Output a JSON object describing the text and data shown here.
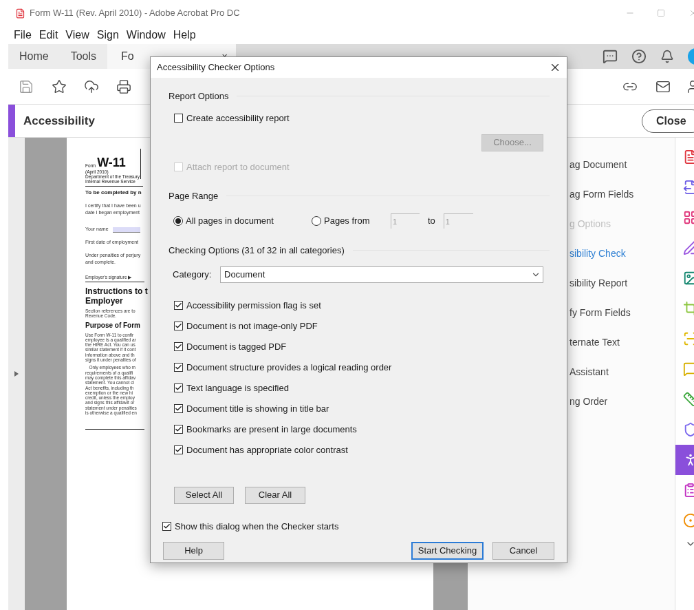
{
  "window": {
    "title": "Form W-11 (Rev. April 2010) - Adobe Acrobat Pro DC"
  },
  "menu": [
    "File",
    "Edit",
    "View",
    "Sign",
    "Window",
    "Help"
  ],
  "tabs": [
    {
      "label": "Home",
      "selected": false
    },
    {
      "label": "Tools",
      "selected": false
    },
    {
      "label": "Fo",
      "selected": true,
      "close": "×"
    }
  ],
  "panel": {
    "title": "Accessibility",
    "close_button": "Close"
  },
  "document": {
    "form_word": "Form",
    "form_number": "W-11",
    "header_lines": [
      "(April 2010)",
      "Department of the Treasury",
      "Internal Revenue Service"
    ],
    "blocks": [
      {
        "kind": "bold",
        "lines": [
          "To be completed by n"
        ]
      },
      {
        "kind": "body",
        "lines": [
          "I certify that I have been u",
          "date I began employment"
        ]
      },
      {
        "kind": "field",
        "lines": [
          "Your name"
        ]
      },
      {
        "kind": "body",
        "lines": [
          "First date of employment"
        ]
      },
      {
        "kind": "body",
        "lines": [
          "Under penalties of perjury",
          "and complete."
        ]
      },
      {
        "kind": "signature",
        "lines": [
          "Employer's signature ▶"
        ]
      },
      {
        "kind": "heading",
        "lines": [
          "Instructions to t",
          "Employer"
        ]
      },
      {
        "kind": "small",
        "lines": [
          "Section references are to",
          "Revenue Code."
        ]
      },
      {
        "kind": "subheading",
        "lines": [
          "Purpose of Form"
        ]
      },
      {
        "kind": "small",
        "lines": [
          "Use Form W-11 to confir",
          "employee is a qualified ar",
          "the HIRE Act. You can us",
          "similar statement if it cont",
          "information above and th",
          "signs it under penalties of"
        ]
      },
      {
        "kind": "small",
        "lines": [
          "   Only employees who m",
          "requirements of a qualifi",
          "may complete this affidav",
          "statement. You cannot cl",
          "Act benefits, including th",
          "exemption or the new hi",
          "credit, unless the employ",
          "and signs this affidavit or",
          "statement under penalties",
          "is otherwise a qualified en"
        ]
      }
    ]
  },
  "tools": [
    {
      "label": "ag Document",
      "selected": false,
      "disabled": false
    },
    {
      "label": "ag Form Fields",
      "selected": false,
      "disabled": false
    },
    {
      "label": "g Options",
      "selected": false,
      "disabled": true
    },
    {
      "label": "sibility Check",
      "selected": true,
      "disabled": false
    },
    {
      "label": "sibility Report",
      "selected": false,
      "disabled": false
    },
    {
      "label": "fy Form Fields",
      "selected": false,
      "disabled": false
    },
    {
      "label": "ternate Text",
      "selected": false,
      "disabled": false
    },
    {
      "label": "Assistant",
      "selected": false,
      "disabled": false
    },
    {
      "label": "ng Order",
      "selected": false,
      "disabled": false
    }
  ],
  "rail": [
    {
      "kind": "create",
      "color": "#e0363f",
      "selected": false
    },
    {
      "kind": "export",
      "color": "#6b5be5",
      "selected": false
    },
    {
      "kind": "organize",
      "color": "#e0357a",
      "selected": false
    },
    {
      "kind": "edit",
      "color": "#9a55e0",
      "selected": false
    },
    {
      "kind": "image",
      "color": "#13866f",
      "selected": false
    },
    {
      "kind": "crop",
      "color": "#8cc63f",
      "selected": false
    },
    {
      "kind": "scan",
      "color": "#e0b800",
      "selected": false
    },
    {
      "kind": "comment",
      "color": "#d8b000",
      "selected": false
    },
    {
      "kind": "measure",
      "color": "#3da83d",
      "selected": false
    },
    {
      "kind": "protect",
      "color": "#7b68ee",
      "selected": false
    },
    {
      "kind": "accessibility",
      "color": "#8a4fdb",
      "selected": true
    },
    {
      "kind": "form",
      "color": "#c12fc1",
      "selected": false
    },
    {
      "kind": "stamp",
      "color": "#f08c00",
      "selected": false
    }
  ],
  "dialog": {
    "title": "Accessibility Checker Options",
    "report_heading": "Report Options",
    "create_report": {
      "label": "Create accessibility report",
      "checked": false,
      "disabled": false
    },
    "choose_button": {
      "label": "Choose...",
      "disabled": true
    },
    "attach_report": {
      "label": "Attach report to document",
      "checked": false,
      "disabled": true
    },
    "range_heading": "Page Range",
    "range_options": [
      {
        "label": "All pages in document",
        "selected": true
      },
      {
        "label": "Pages from",
        "selected": false
      }
    ],
    "from_value": "1",
    "to_label": "to",
    "to_value": "1",
    "checking_heading": "Checking Options (31 of 32 in all categories)",
    "category_label": "Category:",
    "category_value": "Document",
    "checks": [
      {
        "label": "Accessibility permission flag is set",
        "checked": true
      },
      {
        "label": "Document is not image-only PDF",
        "checked": true
      },
      {
        "label": "Document is tagged PDF",
        "checked": true
      },
      {
        "label": "Document structure provides a logical reading order",
        "checked": true
      },
      {
        "label": "Text language is specified",
        "checked": true
      },
      {
        "label": "Document title is showing in title bar",
        "checked": true
      },
      {
        "label": "Bookmarks are present in large documents",
        "checked": true
      },
      {
        "label": "Document has appropriate color contrast",
        "checked": true
      }
    ],
    "select_all": "Select All",
    "clear_all": "Clear All",
    "show_dialog": {
      "label": "Show this dialog when the Checker starts",
      "checked": true
    },
    "help_button": "Help",
    "start_button": "Start Checking",
    "cancel_button": "Cancel"
  }
}
